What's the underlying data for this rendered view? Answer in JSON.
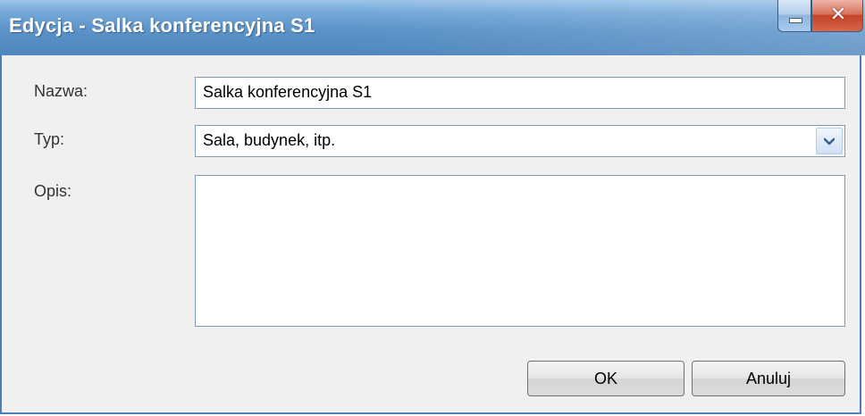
{
  "window": {
    "title": "Edycja - Salka konferencyjna S1",
    "controls": {
      "minimize_icon": "minimize-icon",
      "close_icon": "close-icon",
      "close_glyph": "✕"
    }
  },
  "form": {
    "name": {
      "label": "Nazwa:",
      "value": "Salka konferencyjna S1"
    },
    "type": {
      "label": "Typ:",
      "selected": "Sala, budynek, itp.",
      "icon": "chevron-down-icon"
    },
    "description": {
      "label": "Opis:",
      "value": ""
    }
  },
  "buttons": {
    "ok": "OK",
    "cancel": "Anuluj"
  },
  "colors": {
    "titlebar": "#5b92c8",
    "close_button": "#c2432a",
    "window_bg": "#f0f0f0",
    "field_border": "#7f9db9"
  }
}
